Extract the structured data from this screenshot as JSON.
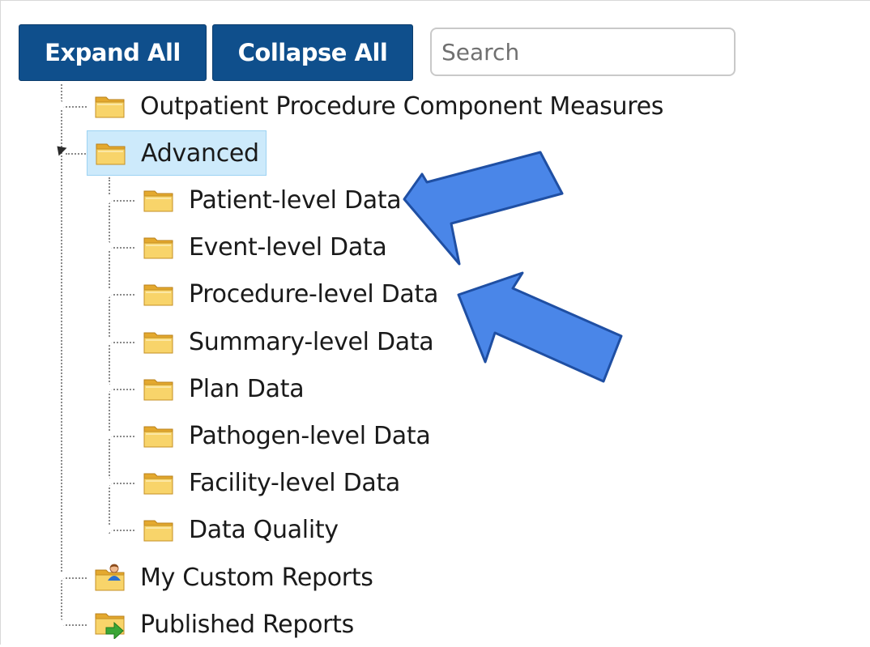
{
  "toolbar": {
    "expand_label": "Expand All",
    "collapse_label": "Collapse All",
    "search_placeholder": "Search"
  },
  "tree": {
    "outpatient": "Outpatient Procedure Component Measures",
    "advanced": "Advanced",
    "children": [
      "Patient-level Data",
      "Event-level Data",
      "Procedure-level Data",
      "Summary-level Data",
      "Plan Data",
      "Pathogen-level Data",
      "Facility-level Data",
      "Data Quality"
    ],
    "my_custom_reports": "My Custom Reports",
    "published_reports": "Published Reports"
  },
  "colors": {
    "button_bg": "#0f4f8c",
    "selected_bg": "#cdeafb",
    "folder": "#f5c84a",
    "callout_arrow": "#4a86e8"
  },
  "icons": {
    "folder": "folder-icon",
    "custom_reports": "folder-user-icon",
    "published": "folder-green-arrow-icon",
    "callout": "callout-arrow"
  }
}
